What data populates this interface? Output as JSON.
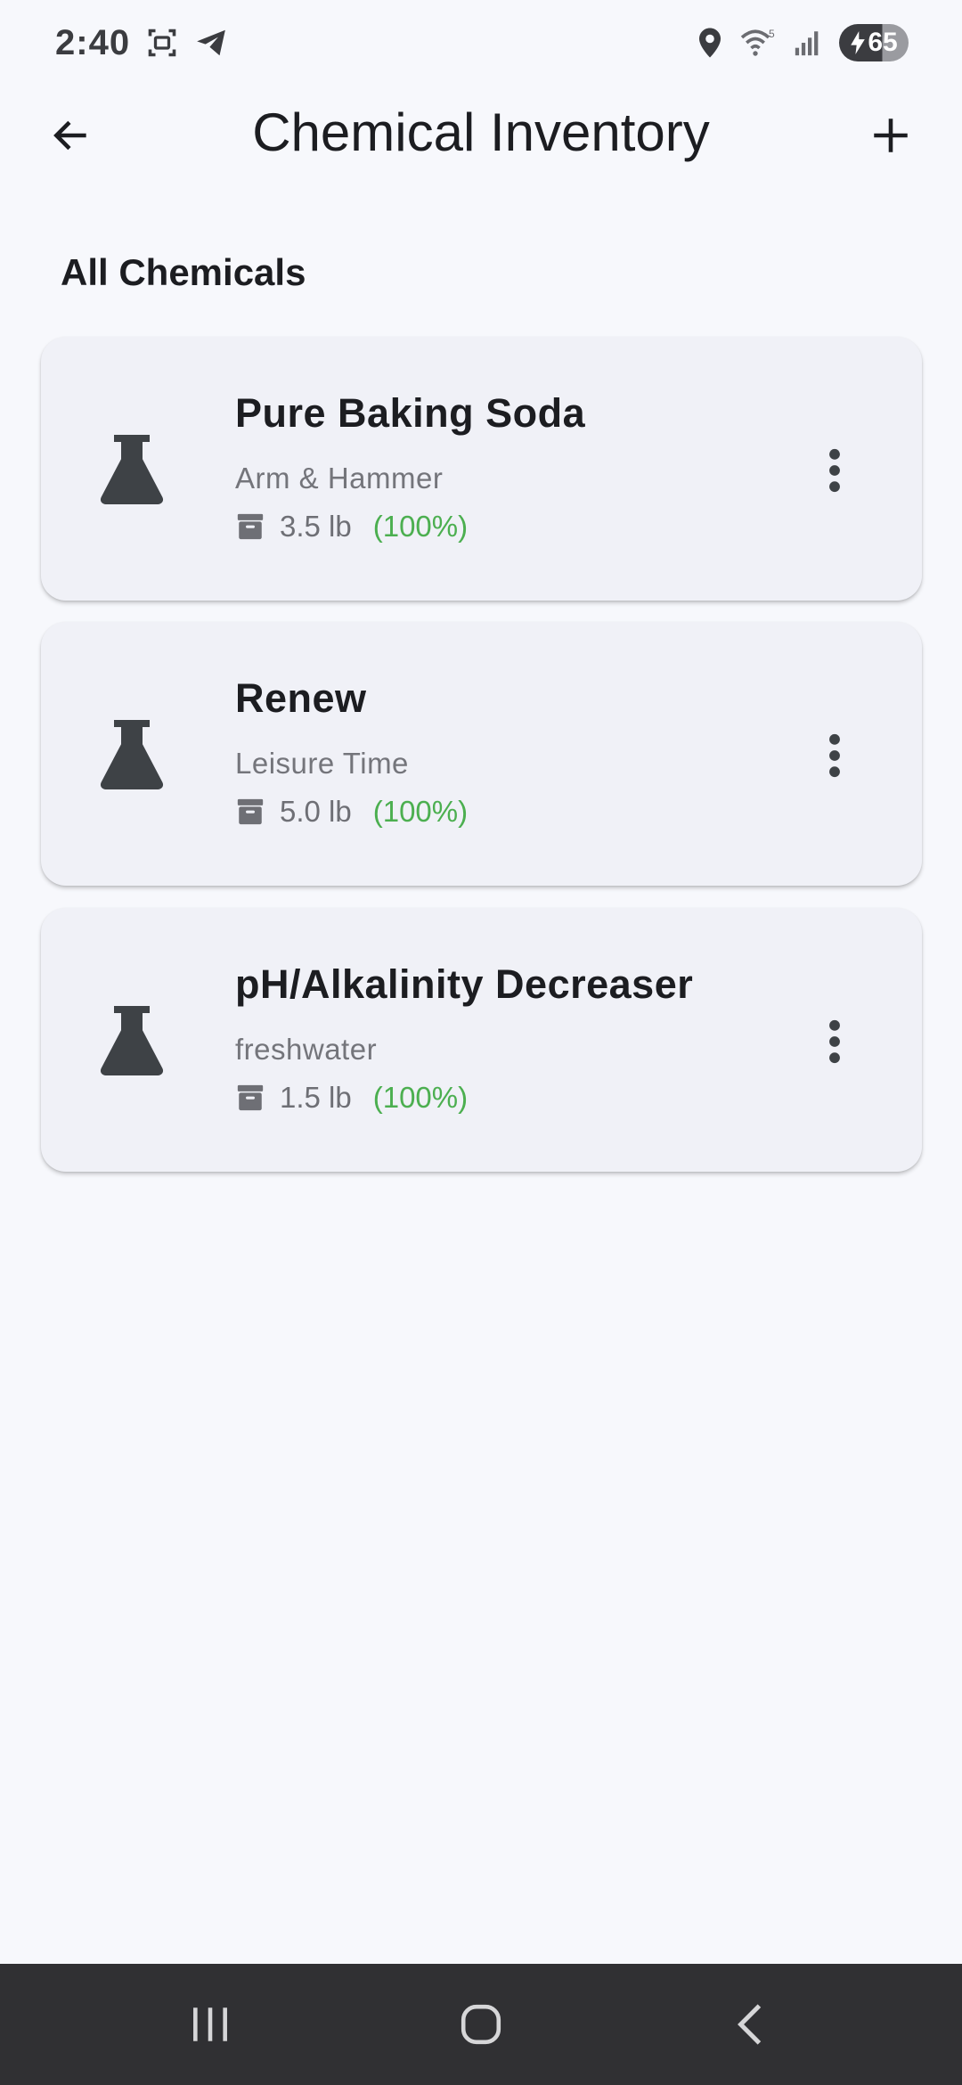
{
  "status_bar": {
    "time": "2:40",
    "battery_level": "65",
    "icons": [
      "screenshot-icon",
      "telegram-icon",
      "location-icon",
      "wifi-icon",
      "signal-icon",
      "battery-charging-icon"
    ]
  },
  "app_bar": {
    "title": "Chemical Inventory",
    "back_icon": "arrow-left-icon",
    "add_icon": "plus-icon"
  },
  "section": {
    "title": "All Chemicals"
  },
  "chemicals": [
    {
      "name": "Pure Baking Soda",
      "brand": "Arm & Hammer",
      "quantity": "3.5 lb",
      "percent": "(100%)"
    },
    {
      "name": "Renew",
      "brand": "Leisure Time",
      "quantity": "5.0 lb",
      "percent": "(100%)"
    },
    {
      "name": "pH/Alkalinity Decreaser",
      "brand": "freshwater",
      "quantity": "1.5 lb",
      "percent": "(100%)"
    }
  ],
  "colors": {
    "background": "#f7f8fc",
    "card": "#f0f1f7",
    "percent_ok": "#4caf50",
    "icon_dark": "#3e4246",
    "nav_bar": "#303033"
  }
}
